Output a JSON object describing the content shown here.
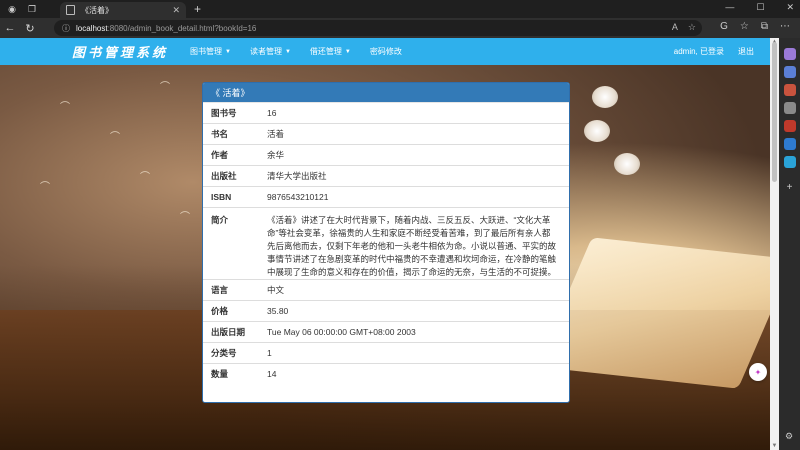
{
  "browser": {
    "tab_title": "《活着》",
    "url_host": "localhost",
    "url_path": ":8080/admin_book_detail.html?bookId=16"
  },
  "navbar": {
    "brand": "图书管理系统",
    "menu": [
      {
        "label": "图书管理"
      },
      {
        "label": "读者管理"
      },
      {
        "label": "借还管理"
      },
      {
        "label": "密码修改"
      }
    ],
    "user_status": "admin, 已登录",
    "logout": "退出"
  },
  "detail": {
    "heading": "《 活着》",
    "rows": [
      {
        "key": "图书号",
        "value": "16"
      },
      {
        "key": "书名",
        "value": "活着"
      },
      {
        "key": "作者",
        "value": "余华"
      },
      {
        "key": "出版社",
        "value": "清华大学出版社"
      },
      {
        "key": "ISBN",
        "value": "9876543210121"
      },
      {
        "key": "简介",
        "value": "《活着》讲述了在大时代背景下，随着内战、三反五反、大跃进、“文化大革命”等社会变革，徐福贵的人生和家庭不断经受着苦难，到了最后所有亲人都先后离他而去，仅剩下年老的他和一头老牛相依为命。小说以普通、平实的故事情节讲述了在急剧变革的时代中福贵的不幸遭遇和坎坷命运，在冷静的笔触中展现了生命的意义和存在的价值，揭示了命运的无奈，与生活的不可捉摸。"
      },
      {
        "key": "语言",
        "value": "中文"
      },
      {
        "key": "价格",
        "value": "35.80"
      },
      {
        "key": "出版日期",
        "value": "Tue May 06 00:00:00 GMT+08:00 2003"
      },
      {
        "key": "分类号",
        "value": "1"
      },
      {
        "key": "数量",
        "value": "14"
      }
    ]
  },
  "colors": {
    "navbar": "#2fb0ec",
    "panel_heading": "#337ab7"
  }
}
